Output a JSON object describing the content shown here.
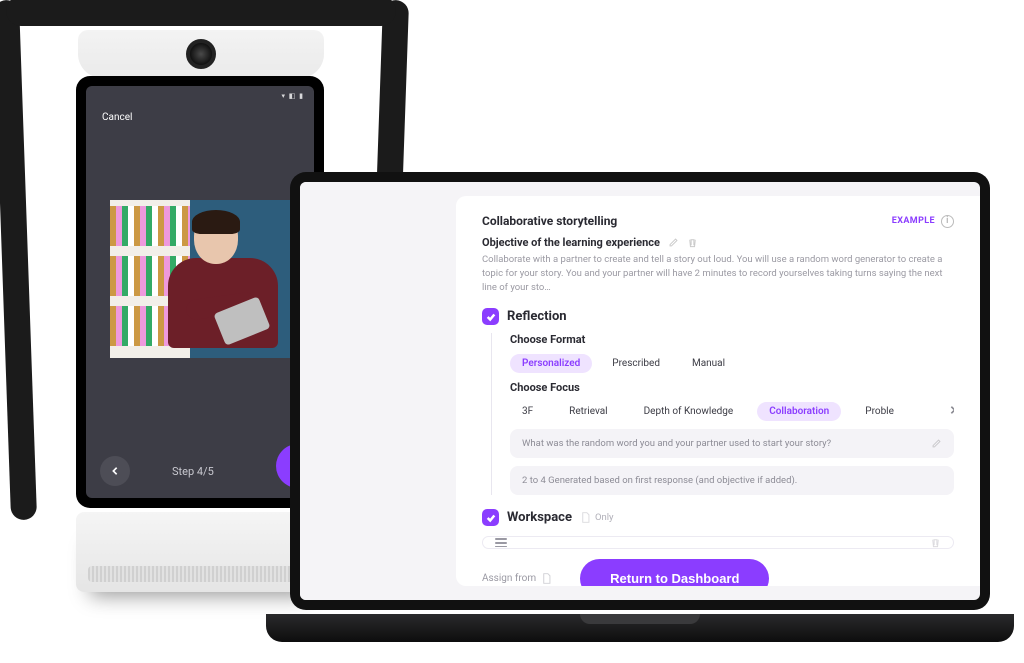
{
  "tablet": {
    "cancel": "Cancel",
    "step": "Step 4/5"
  },
  "card": {
    "title": "Collaborative storytelling",
    "example_badge": "EXAMPLE",
    "objective_label": "Objective of the learning experience",
    "objective_body": "Collaborate with a partner to create and tell a story out loud.  You will use a random word generator to create a topic for your story.  You and your partner will have 2 minutes to record yourselves taking turns saying the next line of your sto…",
    "reflection": {
      "title": "Reflection",
      "format_label": "Choose Format",
      "formats": [
        "Personalized",
        "Prescribed",
        "Manual"
      ],
      "format_selected": "Personalized",
      "focus_label": "Choose Focus",
      "focuses": [
        "3F",
        "Retrieval",
        "Depth of Knowledge",
        "Collaboration",
        "Proble"
      ],
      "focus_selected": "Collaboration",
      "prompt1": "What was the random word you and your partner used to start your story?",
      "prompt2": "2 to 4 Generated based on first response (and objective if added)."
    },
    "workspace": {
      "title": "Workspace",
      "only": "Only"
    },
    "assign_label": "Assign from",
    "cta": "Return to Dashboard"
  }
}
